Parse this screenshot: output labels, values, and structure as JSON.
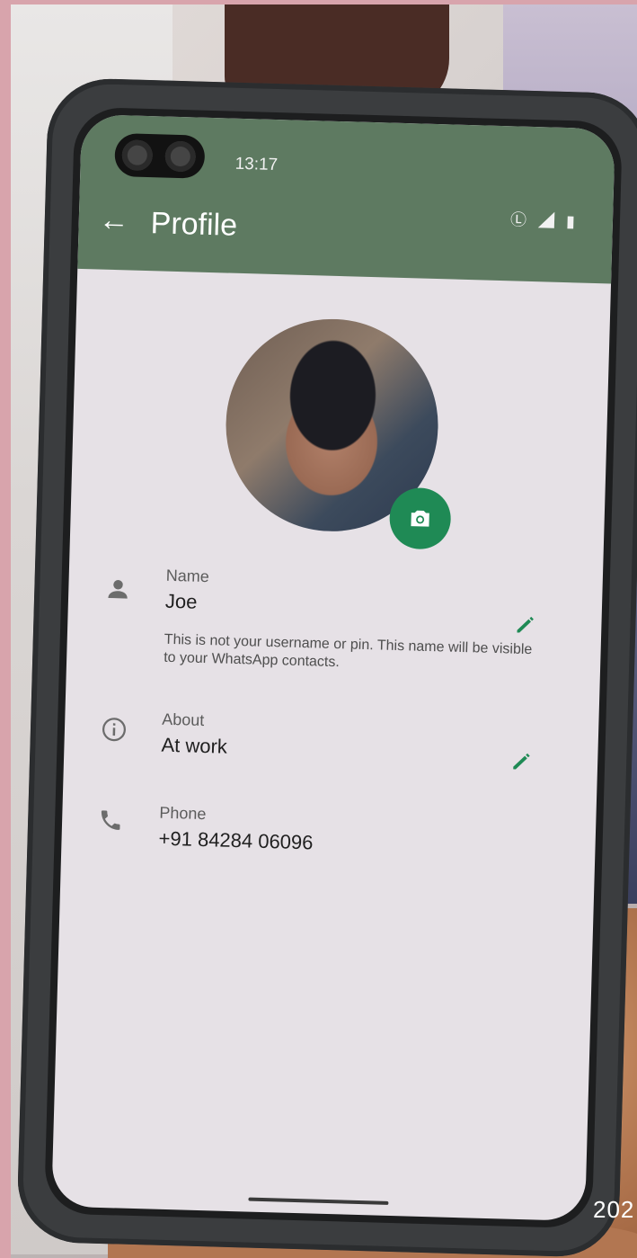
{
  "status_bar": {
    "time": "13:17",
    "icons": "Ⓛ ◢ ▮"
  },
  "appbar": {
    "back_icon": "←",
    "title": "Profile"
  },
  "profile": {
    "name": {
      "label": "Name",
      "value": "Joe",
      "hint": "This is not your username or pin. This name will be visible to your WhatsApp contacts."
    },
    "about": {
      "label": "About",
      "value": "At work"
    },
    "phone": {
      "label": "Phone",
      "value": "+91 84284 06096"
    }
  },
  "photo_overlay": {
    "date_stamp": "202"
  },
  "colors": {
    "appbar": "#5e7a61",
    "accent": "#1f8a55",
    "screen": "#e6e1e6"
  }
}
